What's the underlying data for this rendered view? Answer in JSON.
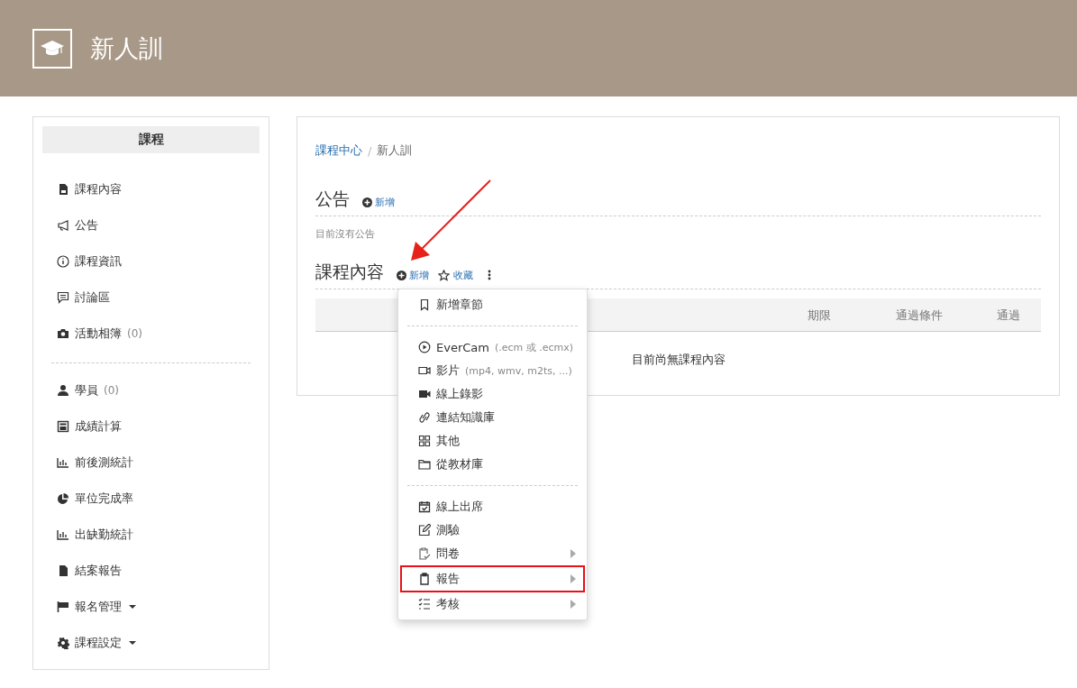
{
  "header": {
    "title": "新人訓"
  },
  "sidebar": {
    "title": "課程",
    "sections": [
      [
        {
          "label": "課程內容",
          "dropdown": false
        },
        {
          "label": "公告",
          "dropdown": false
        },
        {
          "label": "課程資訊",
          "dropdown": false
        },
        {
          "label": "討論區",
          "dropdown": false
        },
        {
          "label": "活動相簿",
          "count": "(0)",
          "dropdown": false
        }
      ],
      [
        {
          "label": "學員",
          "count": "(0)",
          "dropdown": false
        },
        {
          "label": "成績計算",
          "dropdown": false
        },
        {
          "label": "前後測統計",
          "dropdown": false
        },
        {
          "label": "單位完成率",
          "dropdown": false
        },
        {
          "label": "出缺勤統計",
          "dropdown": false
        },
        {
          "label": "結案報告",
          "dropdown": false
        },
        {
          "label": "報名管理",
          "dropdown": true
        },
        {
          "label": "課程設定",
          "dropdown": true
        }
      ]
    ]
  },
  "breadcrumb": [
    {
      "label": "課程中心",
      "link": true
    },
    {
      "label": "新人訓",
      "link": false,
      "separator": "/"
    }
  ],
  "announcements": {
    "title": "公告",
    "add": "新增",
    "empty": "目前沒有公告"
  },
  "content": {
    "title": "課程內容",
    "add": "新增",
    "favorite": "收藏",
    "columns": [
      "期限",
      "通過條件",
      "通過"
    ],
    "empty": "目前尚無課程內容"
  },
  "menu": [
    {
      "kind": "item",
      "label": "新增章節",
      "submenu": false
    },
    {
      "kind": "divider"
    },
    {
      "kind": "item",
      "label": "EverCam",
      "hint": "(.ecm 或 .ecmx)",
      "submenu": false
    },
    {
      "kind": "item",
      "label": "影片",
      "hint": "(mp4, wmv, m2ts, ...)",
      "submenu": false
    },
    {
      "kind": "item",
      "label": "線上錄影",
      "submenu": false
    },
    {
      "kind": "item",
      "label": "連結知識庫",
      "submenu": false
    },
    {
      "kind": "item",
      "label": "其他",
      "submenu": false
    },
    {
      "kind": "item",
      "label": "從教材庫",
      "submenu": false
    },
    {
      "kind": "divider"
    },
    {
      "kind": "item",
      "label": "線上出席",
      "submenu": false
    },
    {
      "kind": "item",
      "label": "測驗",
      "submenu": false
    },
    {
      "kind": "item",
      "label": "問卷",
      "submenu": true
    },
    {
      "kind": "item",
      "label": "報告",
      "submenu": true,
      "highlighted": true
    },
    {
      "kind": "item",
      "label": "考核",
      "submenu": true
    }
  ]
}
